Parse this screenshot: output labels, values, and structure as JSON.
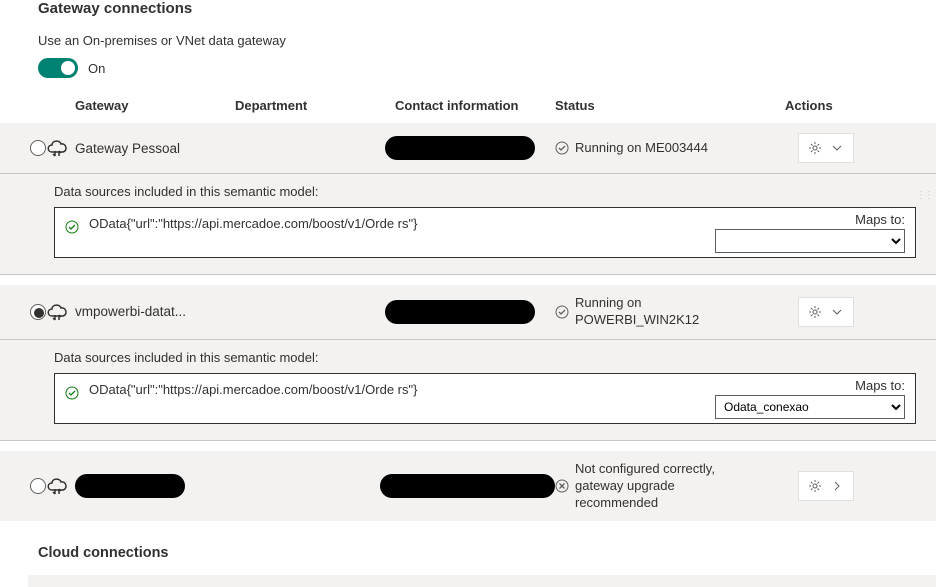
{
  "header": {
    "section_title": "Gateway connections",
    "subtext": "Use an On-premises or VNet data gateway",
    "toggle_label": "On"
  },
  "columns": {
    "gateway": "Gateway",
    "department": "Department",
    "contact": "Contact information",
    "status": "Status",
    "actions": "Actions"
  },
  "gateways": [
    {
      "selected": false,
      "name": "Gateway Pessoal",
      "status_ok": true,
      "status_text": "Running on ME003444",
      "expanded": true,
      "ds_label": "Data sources included in this semantic model:",
      "ds_text": "OData{\"url\":\"https://api.mercadoe.com/boost/v1/Orde rs\"}",
      "maps_label": "Maps to:",
      "maps_value": ""
    },
    {
      "selected": true,
      "name": "vmpowerbi-datat...",
      "status_ok": true,
      "status_text": "Running on POWERBI_WIN2K12",
      "expanded": true,
      "ds_label": "Data sources included in this semantic model:",
      "ds_text": "OData{\"url\":\"https://api.mercadoe.com/boost/v1/Orde rs\"}",
      "maps_label": "Maps to:",
      "maps_value": "Odata_conexao"
    },
    {
      "selected": false,
      "name": "",
      "name_redacted": true,
      "status_ok": false,
      "status_text": "Not configured correctly, gateway upgrade recommended",
      "expanded": false
    }
  ],
  "cloud_section_title": "Cloud connections"
}
